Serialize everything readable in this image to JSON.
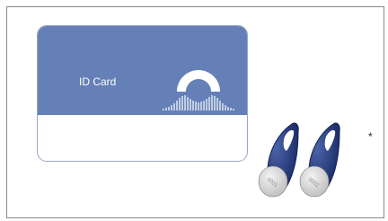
{
  "card": {
    "label": "ID Card",
    "color": "#6480b7"
  },
  "fobs": {
    "tags": [
      "0001",
      "0002"
    ],
    "color": "#243a80"
  },
  "note_marker": "*"
}
